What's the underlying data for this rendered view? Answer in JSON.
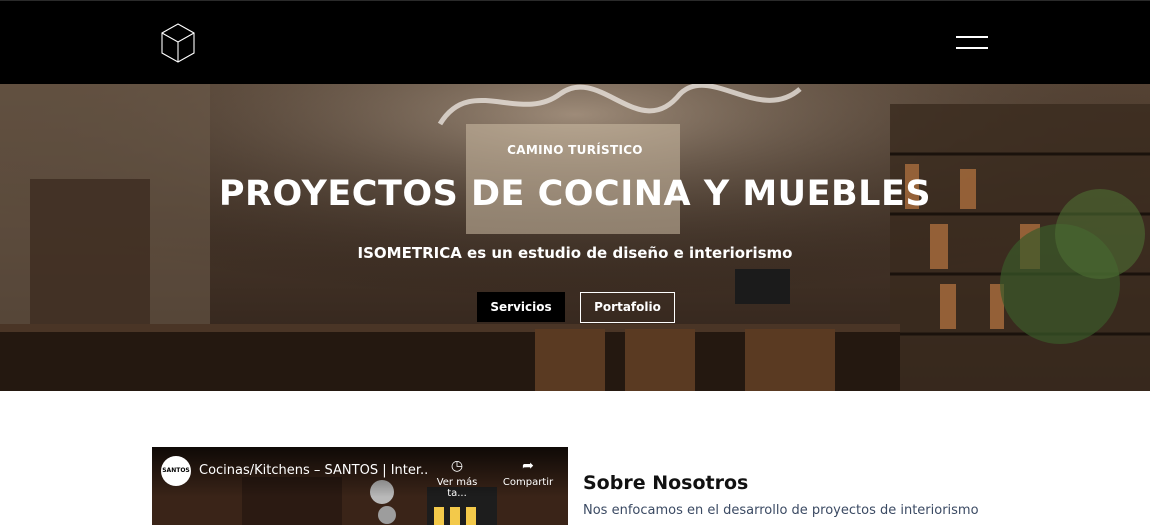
{
  "header": {
    "logo_icon": "isometric-cube-icon",
    "menu_icon": "hamburger-menu-icon"
  },
  "hero": {
    "eyebrow": "CAMINO TURÍSTICO",
    "title": "PROYECTOS DE COCINA Y MUEBLES",
    "subtitle": "ISOMETRICA es un estudio de diseño e interiorismo",
    "buttons": {
      "services": "Servicios",
      "portfolio": "Portafolio"
    },
    "background_scene": "kitchen-interior-photo"
  },
  "video": {
    "channel": "SANTOS",
    "title": "Cocinas/Kitchens – SANTOS | Inter...",
    "watch_later": "Ver más ta...",
    "share": "Compartir"
  },
  "about": {
    "title": "Sobre Nosotros",
    "text": "Nos enfocamos en el desarrollo de proyectos de interiorismo"
  },
  "colors": {
    "header_bg": "#000000",
    "about_text": "#3b4a63"
  }
}
